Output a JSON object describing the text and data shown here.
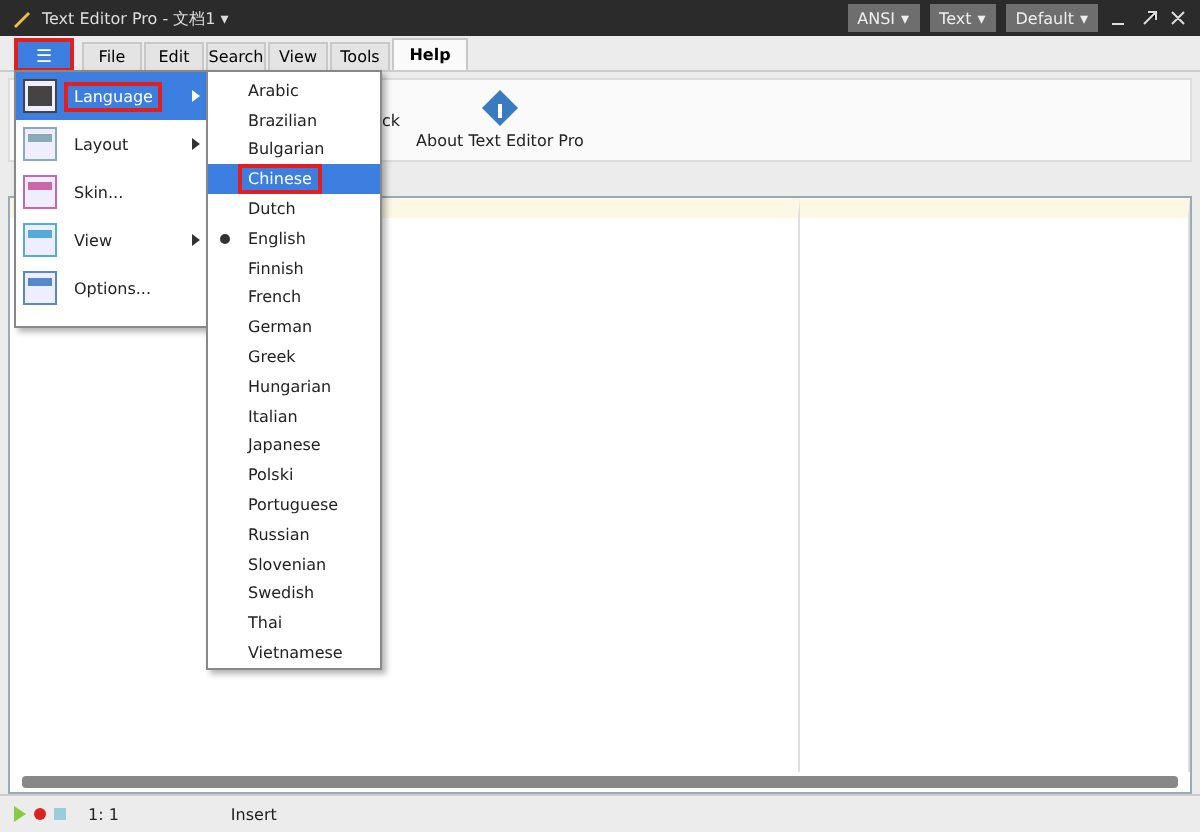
{
  "window": {
    "title": "Text Editor Pro",
    "separator": "-",
    "document": "文档1",
    "caret": "▾",
    "selectors": [
      {
        "label": "ANSI"
      },
      {
        "label": "Text"
      },
      {
        "label": "Default"
      }
    ]
  },
  "app_menu_button": {
    "glyph": "☰",
    "annotated": true
  },
  "tabs": [
    {
      "label": "File",
      "selected": false
    },
    {
      "label": "Edit",
      "selected": false
    },
    {
      "label": "Search",
      "selected": false
    },
    {
      "label": "View",
      "selected": false
    },
    {
      "label": "Tools",
      "selected": false
    },
    {
      "label": "Help",
      "selected": true
    }
  ],
  "ribbon": {
    "partial_label": "ck",
    "about_button": "About Text Editor Pro"
  },
  "app_menu": [
    {
      "label": "Language",
      "submenu": true,
      "selected": true,
      "annotated": true
    },
    {
      "label": "Layout",
      "submenu": true,
      "selected": false,
      "annotated": false
    },
    {
      "label": "Skin...",
      "submenu": false,
      "selected": false,
      "annotated": false
    },
    {
      "label": "View",
      "submenu": true,
      "selected": false,
      "annotated": false
    },
    {
      "label": "Options...",
      "submenu": false,
      "selected": false,
      "annotated": false
    }
  ],
  "languages": [
    {
      "label": "Arabic",
      "selected": false,
      "checked": false,
      "annotated": false
    },
    {
      "label": "Brazilian",
      "selected": false,
      "checked": false,
      "annotated": false
    },
    {
      "label": "Bulgarian",
      "selected": false,
      "checked": false,
      "annotated": false
    },
    {
      "label": "Chinese",
      "selected": true,
      "checked": false,
      "annotated": true
    },
    {
      "label": "Dutch",
      "selected": false,
      "checked": false,
      "annotated": false
    },
    {
      "label": "English",
      "selected": false,
      "checked": true,
      "annotated": false
    },
    {
      "label": "Finnish",
      "selected": false,
      "checked": false,
      "annotated": false
    },
    {
      "label": "French",
      "selected": false,
      "checked": false,
      "annotated": false
    },
    {
      "label": "German",
      "selected": false,
      "checked": false,
      "annotated": false
    },
    {
      "label": "Greek",
      "selected": false,
      "checked": false,
      "annotated": false
    },
    {
      "label": "Hungarian",
      "selected": false,
      "checked": false,
      "annotated": false
    },
    {
      "label": "Italian",
      "selected": false,
      "checked": false,
      "annotated": false
    },
    {
      "label": "Japanese",
      "selected": false,
      "checked": false,
      "annotated": false
    },
    {
      "label": "Polski",
      "selected": false,
      "checked": false,
      "annotated": false
    },
    {
      "label": "Portuguese",
      "selected": false,
      "checked": false,
      "annotated": false
    },
    {
      "label": "Russian",
      "selected": false,
      "checked": false,
      "annotated": false
    },
    {
      "label": "Slovenian",
      "selected": false,
      "checked": false,
      "annotated": false
    },
    {
      "label": "Swedish",
      "selected": false,
      "checked": false,
      "annotated": false
    },
    {
      "label": "Thai",
      "selected": false,
      "checked": false,
      "annotated": false
    },
    {
      "label": "Vietnamese",
      "selected": false,
      "checked": false,
      "annotated": false
    }
  ],
  "status_bar": {
    "position": "1: 1",
    "mode": "Insert"
  }
}
